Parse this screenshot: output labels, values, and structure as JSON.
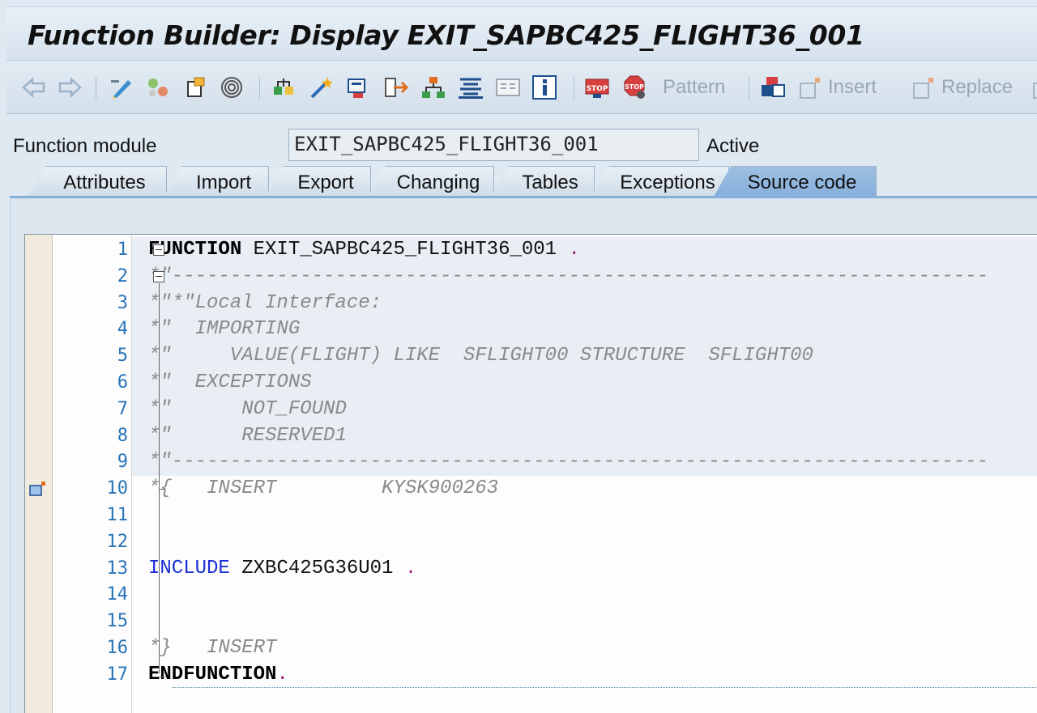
{
  "window": {
    "title": "Function Builder: Display EXIT_SAPBC425_FLIGHT36_001"
  },
  "toolbar": {
    "back_icon": "back-arrow-icon",
    "forward_icon": "forward-arrow-icon",
    "pattern_label": "Pattern",
    "insert_label": "Insert",
    "replace_label": "Replace"
  },
  "header": {
    "function_module_label": "Function module",
    "function_module_value": "EXIT_SAPBC425_FLIGHT36_001",
    "status": "Active"
  },
  "tabs": [
    {
      "label": "Attributes",
      "active": false
    },
    {
      "label": "Import",
      "active": false
    },
    {
      "label": "Export",
      "active": false
    },
    {
      "label": "Changing",
      "active": false
    },
    {
      "label": "Tables",
      "active": false
    },
    {
      "label": "Exceptions",
      "active": false
    },
    {
      "label": "Source code",
      "active": true
    }
  ],
  "colors": {
    "active_tab": "#86aedb",
    "line_number": "#2a74b8",
    "keyword_blue": "#1a2fd6",
    "comment": "#8a8a8a"
  },
  "source": {
    "lines": [
      {
        "n": "1",
        "parts": [
          {
            "t": "FUNCTION",
            "c": "kw-bold"
          },
          {
            "t": " EXIT_SAPBC425_FLIGHT36_001 ",
            "c": ""
          },
          {
            "t": ".",
            "c": "dot-red"
          }
        ]
      },
      {
        "n": "2",
        "parts": [
          {
            "t": "*\"----------------------------------------------------------------------",
            "c": "comment"
          }
        ]
      },
      {
        "n": "3",
        "parts": [
          {
            "t": "*\"*\"Local Interface:",
            "c": "comment"
          }
        ]
      },
      {
        "n": "4",
        "parts": [
          {
            "t": "*\"  IMPORTING",
            "c": "comment"
          }
        ]
      },
      {
        "n": "5",
        "parts": [
          {
            "t": "*\"     VALUE(FLIGHT) LIKE  SFLIGHT00 STRUCTURE  SFLIGHT00",
            "c": "comment"
          }
        ]
      },
      {
        "n": "6",
        "parts": [
          {
            "t": "*\"  EXCEPTIONS",
            "c": "comment"
          }
        ]
      },
      {
        "n": "7",
        "parts": [
          {
            "t": "*\"      NOT_FOUND",
            "c": "comment"
          }
        ]
      },
      {
        "n": "8",
        "parts": [
          {
            "t": "*\"      RESERVED1",
            "c": "comment"
          }
        ]
      },
      {
        "n": "9",
        "parts": [
          {
            "t": "*\"----------------------------------------------------------------------",
            "c": "comment"
          }
        ]
      },
      {
        "n": "10",
        "parts": [
          {
            "t": "*{   INSERT         KYSK900263",
            "c": "comment"
          }
        ]
      },
      {
        "n": "11",
        "parts": []
      },
      {
        "n": "12",
        "parts": []
      },
      {
        "n": "13",
        "parts": [
          {
            "t": "INCLUDE",
            "c": "kw-blue"
          },
          {
            "t": " ZXBC425G36U01 ",
            "c": ""
          },
          {
            "t": ".",
            "c": "dot-red"
          }
        ]
      },
      {
        "n": "14",
        "parts": []
      },
      {
        "n": "15",
        "parts": []
      },
      {
        "n": "16",
        "parts": [
          {
            "t": "*}   INSERT",
            "c": "comment"
          }
        ]
      },
      {
        "n": "17",
        "parts": [
          {
            "t": "ENDFUNCTION",
            "c": "kw-bold"
          },
          {
            "t": ".",
            "c": "dot-red"
          }
        ]
      }
    ]
  }
}
